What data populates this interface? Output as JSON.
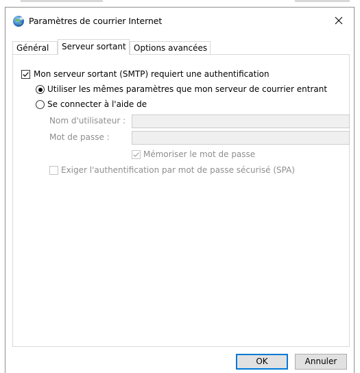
{
  "window": {
    "title": "Paramètres de courrier Internet"
  },
  "tabs": [
    {
      "label": "Général",
      "active": false
    },
    {
      "label": "Serveur sortant",
      "active": true
    },
    {
      "label": "Options avancées",
      "active": false
    }
  ],
  "outgoing": {
    "auth_required_label": "Mon serveur sortant (SMTP) requiert une authentification",
    "auth_required_checked": true,
    "same_settings_label": "Utiliser les mêmes paramètres que mon serveur de courrier entrant",
    "same_settings_selected": true,
    "log_on_using_label": "Se connecter à l'aide de",
    "log_on_using_selected": false,
    "username_label": "Nom d'utilisateur :",
    "username_value": "",
    "password_label": "Mot de passe :",
    "password_value": "",
    "remember_password_label": "Mémoriser le mot de passe",
    "remember_password_checked": true,
    "spa_label": "Exiger l'authentification par mot de passe sécurisé (SPA)",
    "spa_checked": false
  },
  "buttons": {
    "ok_label": "OK",
    "cancel_label": "Annuler"
  },
  "colors": {
    "accent": "#0078d7",
    "disabled_text": "#8d8d8d"
  }
}
